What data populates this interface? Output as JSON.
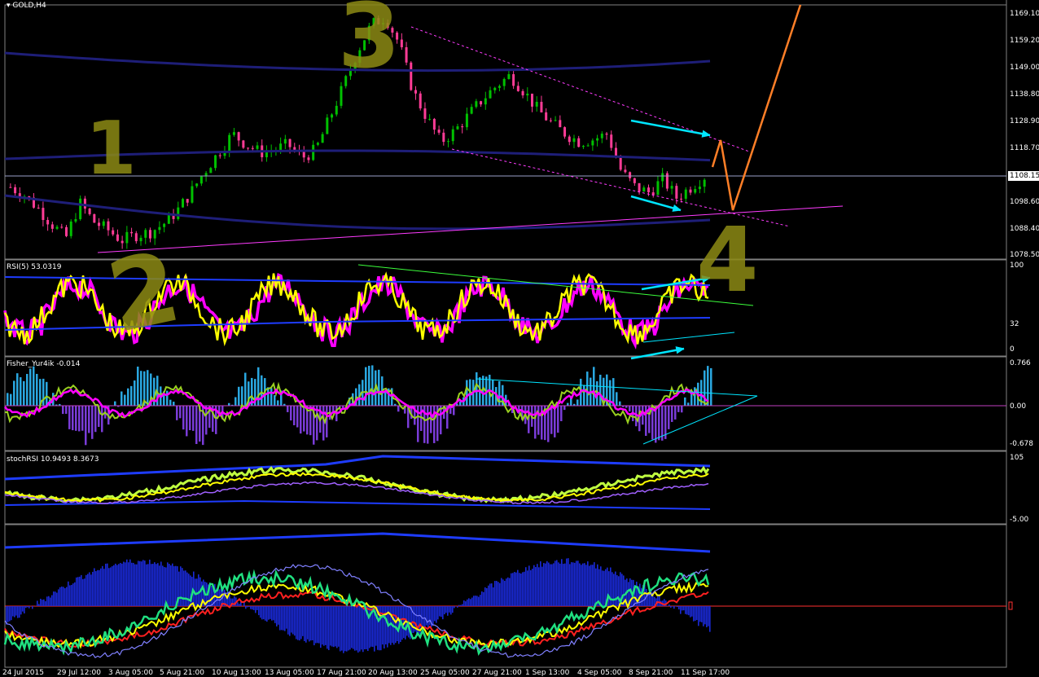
{
  "symbol_title": "GOLD,H4",
  "panes": [
    {
      "id": "price",
      "title": "GOLD,H4"
    },
    {
      "id": "rsi",
      "title": "RSI(5) 53.0319"
    },
    {
      "id": "fisher",
      "title": "Fisher_Yur4ik -0.014"
    },
    {
      "id": "stochrsi",
      "title": "stochRSI 10.9493 8.3673"
    },
    {
      "id": "osc",
      "title": ""
    }
  ],
  "price_axis": [
    "1169.10",
    "1159.20",
    "1149.00",
    "1138.80",
    "1128.90",
    "1118.70",
    "1108.15",
    "1098.60",
    "1088.40",
    "1078.50"
  ],
  "current_price": "1108.15",
  "rsi_axis": [
    "100",
    "32",
    "0"
  ],
  "fisher_axis": [
    "0.766",
    "0.00",
    "-0.678"
  ],
  "stoch_axis": [
    "105",
    "-5.00"
  ],
  "time_axis": [
    "24 Jul 2015",
    "29 Jul 12:00",
    "3 Aug 05:00",
    "5 Aug 21:00",
    "10 Aug 13:00",
    "13 Aug 05:00",
    "17 Aug 21:00",
    "20 Aug 13:00",
    "25 Aug 05:00",
    "27 Aug 21:00",
    "1 Sep 13:00",
    "4 Sep 05:00",
    "8 Sep 21:00",
    "11 Sep 17:00"
  ],
  "wave_labels": [
    "1",
    "2",
    "3",
    "4"
  ],
  "colors": {
    "bull": "#00c000",
    "bear": "#ff3c96",
    "envelope": "#1e1e78",
    "rsi": "#ffff00",
    "fisher": "#ff00ff",
    "cyan": "#00e5ff",
    "orange": "#ff7f27",
    "wave": "#8c8a14"
  },
  "chart_data": {
    "type": "line",
    "title": "GOLD,H4",
    "series": [
      {
        "values": [
          1104,
          1101,
          1096,
          1090,
          1085,
          1098,
          1091,
          1088,
          1084,
          1086,
          1087,
          1090,
          1095,
          1102,
          1110,
          1117,
          1124,
          1120,
          1117,
          1118,
          1120,
          1115,
          1118,
          1130,
          1142,
          1155,
          1165,
          1168,
          1158,
          1140,
          1130,
          1121,
          1125,
          1131,
          1137,
          1142,
          1146,
          1140,
          1133,
          1128,
          1124,
          1121,
          1122,
          1124,
          1110,
          1104,
          1102,
          1107,
          1100,
          1104,
          1108
        ]
      }
    ],
    "ylim": [
      1078.5,
      1169.1
    ]
  }
}
